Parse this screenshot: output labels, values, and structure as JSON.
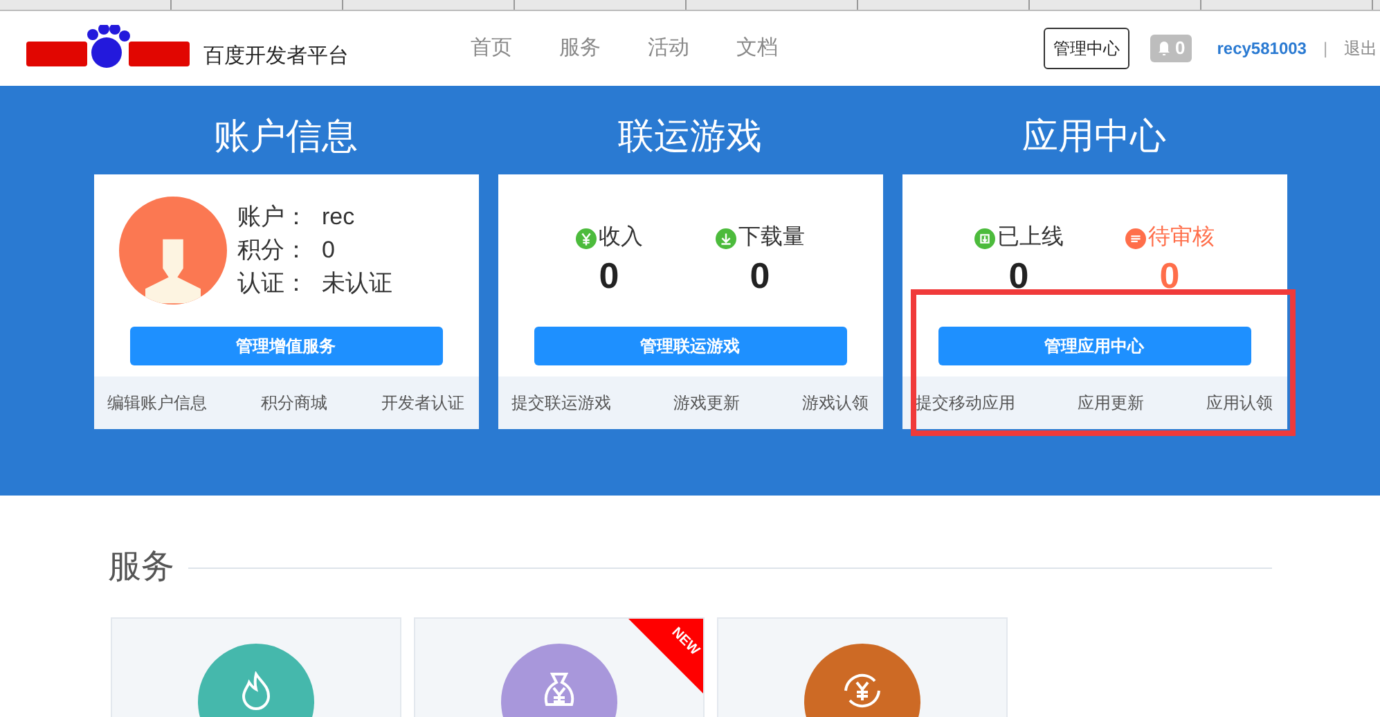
{
  "header": {
    "brand": "百度开发者平台",
    "nav": [
      {
        "label": "首页",
        "selected": false
      },
      {
        "label": "服务",
        "selected": false
      },
      {
        "label": "活动",
        "selected": false
      },
      {
        "label": "文档",
        "selected": false
      }
    ],
    "manage_button": "管理中心",
    "notifications": "0",
    "username": "recy581003",
    "separator": "|",
    "logout": "退出"
  },
  "panels": [
    {
      "kind": "account",
      "title": "账户信息",
      "fields": [
        {
          "label": "账户：",
          "value": "rec"
        },
        {
          "label": "积分：",
          "value": "0"
        },
        {
          "label": "认证：",
          "value": "未认证"
        }
      ],
      "button": "管理增值服务",
      "links": [
        "编辑账户信息",
        "积分商城",
        "开发者认证"
      ],
      "highlighted": false
    },
    {
      "kind": "stats",
      "title": "联运游戏",
      "stats": [
        {
          "kind": "income",
          "label": "收入",
          "value": "0",
          "color": "#4cbb3c"
        },
        {
          "kind": "downloads",
          "label": "下载量",
          "value": "0",
          "color": "#4cbb3c"
        }
      ],
      "button": "管理联运游戏",
      "links": [
        "提交联运游戏",
        "游戏更新",
        "游戏认领"
      ],
      "highlighted": false
    },
    {
      "kind": "stats",
      "title": "应用中心",
      "stats": [
        {
          "kind": "online",
          "label": "已上线",
          "value": "0",
          "color": "#4cbb3c"
        },
        {
          "kind": "pending",
          "label": "待审核",
          "value": "0",
          "color": "#ff6e4a"
        }
      ],
      "button": "管理应用中心",
      "links": [
        "提交移动应用",
        "应用更新",
        "应用认领"
      ],
      "highlighted": true
    }
  ],
  "services": {
    "title": "服务",
    "tiles": [
      {
        "kind": "hot",
        "color": "#45b8ac",
        "new": false
      },
      {
        "kind": "money",
        "color": "#a897db",
        "new": true,
        "badge": "NEW"
      },
      {
        "kind": "exchange",
        "color": "#cd6a25",
        "new": false
      }
    ]
  }
}
